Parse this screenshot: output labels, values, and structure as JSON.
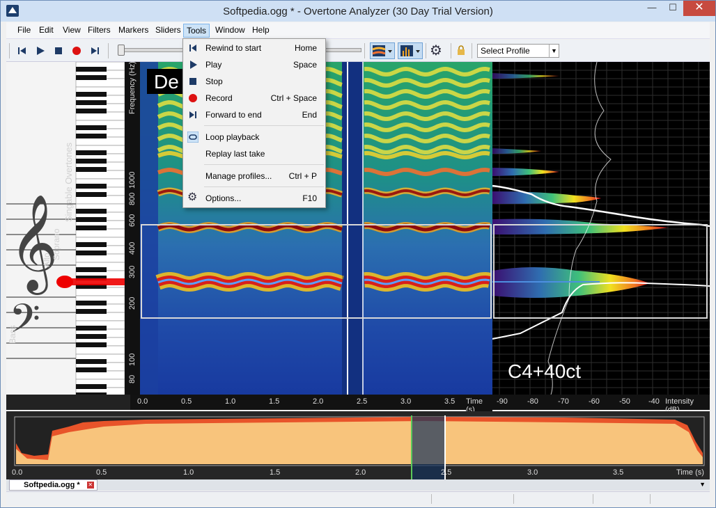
{
  "window": {
    "title": "Softpedia.ogg * - Overtone Analyzer (30 Day Trial Version)",
    "minimize": "—",
    "maximize": "☐",
    "close": "✕"
  },
  "menubar": [
    "File",
    "Edit",
    "View",
    "Filters",
    "Markers",
    "Sliders",
    "Tools",
    "Window",
    "Help"
  ],
  "toolbar": {
    "transport_icons": [
      "rewind-icon",
      "play-icon",
      "stop-icon",
      "record-icon",
      "forward-icon"
    ],
    "profile_select": "Select Profile",
    "gear_icon": "⚙"
  },
  "tools_menu": {
    "items": [
      {
        "label": "Rewind to start",
        "shortcut": "Home"
      },
      {
        "label": "Play",
        "shortcut": "Space"
      },
      {
        "label": "Stop",
        "shortcut": ""
      },
      {
        "label": "Record",
        "shortcut": "Ctrl + Space"
      },
      {
        "label": "Forward to end",
        "shortcut": "End"
      },
      {
        "label": "Loop playback",
        "shortcut": ""
      },
      {
        "label": "Replay last take",
        "shortcut": ""
      },
      {
        "label": "Manage profiles...",
        "shortcut": "Ctrl + P"
      },
      {
        "label": "Options...",
        "shortcut": "F10"
      }
    ]
  },
  "piano": {
    "voice_labels": [
      "Bass",
      "Alto",
      "Soprano",
      "Singable Overtones"
    ]
  },
  "spectrogram": {
    "overlay_text": "De",
    "frequency_axis_label": "Frequency (Hz)",
    "frequency_ticks": [
      "1000",
      "800",
      "600",
      "400",
      "300",
      "200",
      "100",
      "80"
    ],
    "time_axis_label": "Time (s)",
    "time_ticks": [
      "0.0",
      "0.5",
      "1.0",
      "1.5",
      "2.0",
      "2.5",
      "3.0",
      "3.5"
    ]
  },
  "spectrum": {
    "note_readout": "C4+40ct",
    "intensity_axis_label": "Intensity (dB)",
    "intensity_ticks": [
      "-90",
      "-80",
      "-70",
      "-60",
      "-50",
      "-40"
    ]
  },
  "waveform": {
    "time_axis_label": "Time (s)",
    "time_ticks": [
      "0.0",
      "0.5",
      "1.0",
      "1.5",
      "2.0",
      "2.5",
      "3.0",
      "3.5"
    ]
  },
  "tabs": [
    {
      "label": "Softpedia.ogg *",
      "close": "✕"
    }
  ],
  "tab_dropdown": "▼",
  "colors": {
    "accent": "#cde3f7",
    "waveform_fill": "#f8c47c",
    "waveform_edge": "#e8542a",
    "harmonic_red": "#c0101a",
    "marker_line": "#5bc85b"
  }
}
